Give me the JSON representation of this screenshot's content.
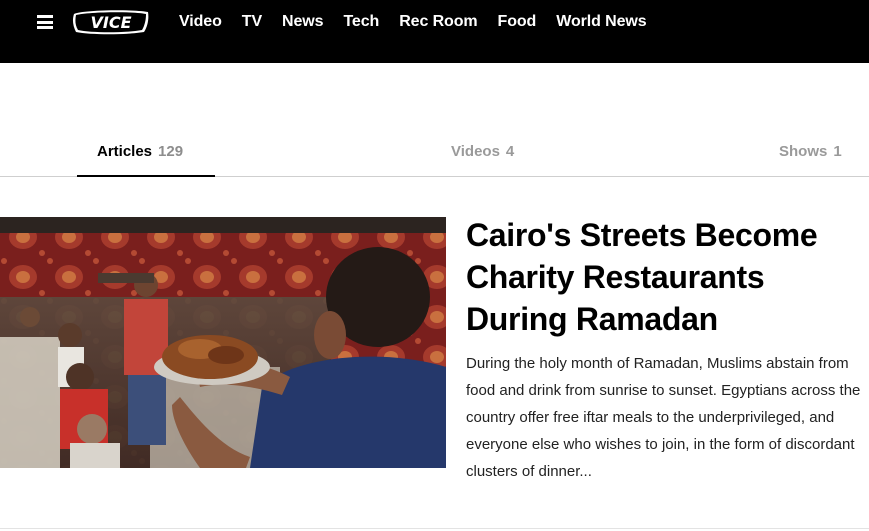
{
  "header": {
    "logo_text": "VICE",
    "menu_icon": "hamburger-menu-icon",
    "nav_items": [
      {
        "label": "Video"
      },
      {
        "label": "TV"
      },
      {
        "label": "News"
      },
      {
        "label": "Tech"
      },
      {
        "label": "Rec Room"
      },
      {
        "label": "Food"
      },
      {
        "label": "World News"
      }
    ]
  },
  "tabs": [
    {
      "label": "Articles",
      "count": "129",
      "active": true
    },
    {
      "label": "Videos",
      "count": "4",
      "active": false
    },
    {
      "label": "Shows",
      "count": "1",
      "active": false
    }
  ],
  "article": {
    "title": "Cairo's Streets Become Charity Restaurants During Ramadan",
    "summary": "During the holy month of Ramadan, Muslims abstain from food and drink from sunrise to sunset. Egyptians across the country offer free iftar meals to the underprivileged, and everyone else who wishes to join, in the form of discordant clusters of dinner..."
  },
  "colors": {
    "header_bg": "#000000",
    "active_tab": "#000000",
    "inactive_tab": "#9a9a9a",
    "divider": "#cfcfcf"
  }
}
